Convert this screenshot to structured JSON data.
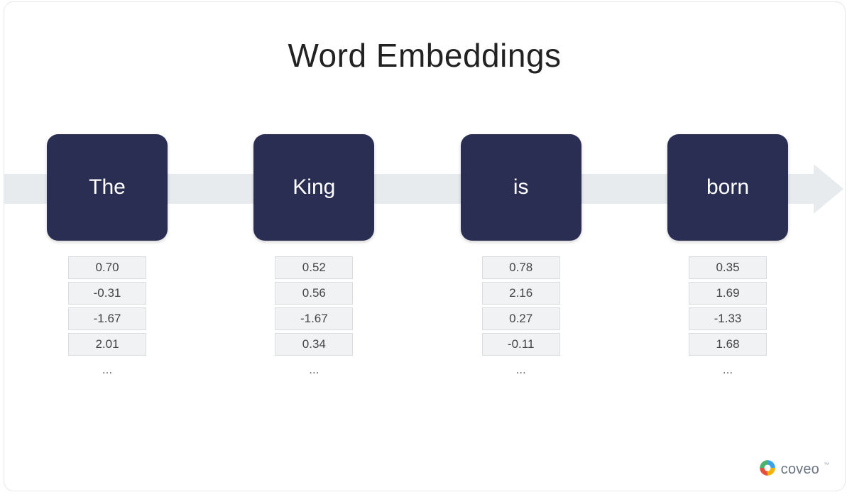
{
  "title": "Word Embeddings",
  "tokens": [
    {
      "word": "The",
      "values": [
        "0.70",
        "-0.31",
        "-1.67",
        "2.01",
        "..."
      ]
    },
    {
      "word": "King",
      "values": [
        "0.52",
        "0.56",
        "-1.67",
        "0.34",
        "..."
      ]
    },
    {
      "word": "is",
      "values": [
        "0.78",
        "2.16",
        "0.27",
        "-0.11",
        "..."
      ]
    },
    {
      "word": "born",
      "values": [
        "0.35",
        "1.69",
        "-1.33",
        "1.68",
        "..."
      ]
    }
  ],
  "brand": {
    "name": "coveo",
    "tm": "™"
  }
}
